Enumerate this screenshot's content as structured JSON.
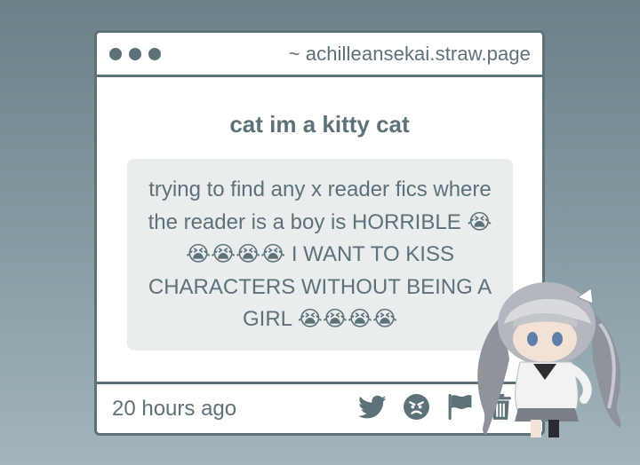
{
  "window": {
    "url": "~ achilleansekai.straw.page"
  },
  "post": {
    "username": "cat im a kitty cat",
    "message": "trying to find any x reader fics where the reader is a boy is HORRIBLE 😭😭😭😭😭 I WANT TO KISS CHARACTERS WITHOUT BEING A GIRL 😭😭😭😭",
    "timestamp": "20 hours ago"
  },
  "actions": {
    "icons": [
      "twitter-icon",
      "angry-face-icon",
      "flag-icon",
      "trash-icon"
    ]
  },
  "colors": {
    "accent": "#5d7178",
    "card_background": "#ffffff",
    "message_background": "#e9edee"
  }
}
